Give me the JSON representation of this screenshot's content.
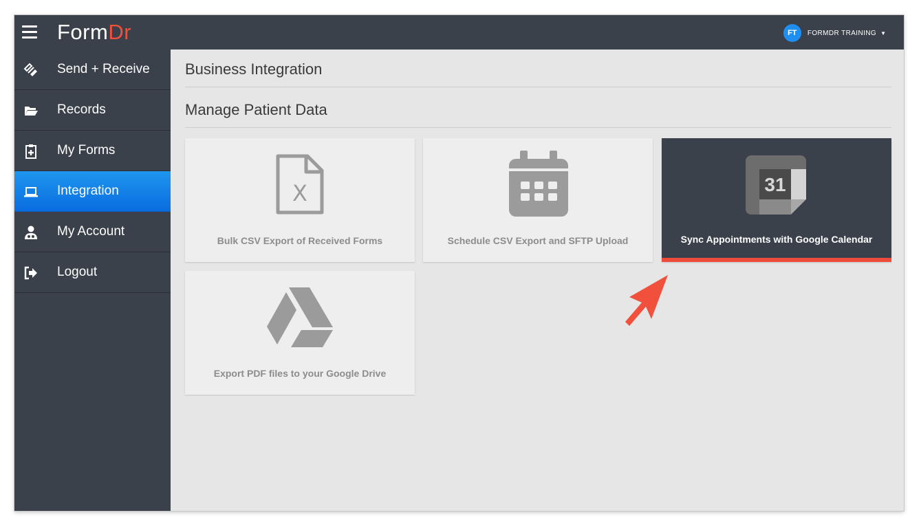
{
  "app": {
    "logo_form": "Form",
    "logo_dr": "Dr",
    "user_initials": "FT",
    "user_name": "FORMDR TRAINING",
    "user_caret": "▼"
  },
  "sidebar": {
    "items": [
      {
        "label": "Send + Receive",
        "icon": "send-receive-icon",
        "active": false
      },
      {
        "label": "Records",
        "icon": "folder-open-icon",
        "active": false
      },
      {
        "label": "My Forms",
        "icon": "clipboard-plus-icon",
        "active": false
      },
      {
        "label": "Integration",
        "icon": "laptop-icon",
        "active": true
      },
      {
        "label": "My Account",
        "icon": "user-doctor-icon",
        "active": false
      },
      {
        "label": "Logout",
        "icon": "sign-out-icon",
        "active": false
      }
    ]
  },
  "main": {
    "title": "Business Integration",
    "section_title": "Manage Patient Data",
    "tiles": [
      {
        "label": "Bulk CSV Export of Received Forms",
        "icon": "excel-file-icon",
        "selected": false
      },
      {
        "label": "Schedule CSV Export and SFTP Upload",
        "icon": "calendar-icon",
        "selected": false
      },
      {
        "label": "Sync Appointments with Google Calendar",
        "icon": "google-calendar-icon",
        "calendar_day": "31",
        "selected": true
      },
      {
        "label": "Export PDF files to your Google Drive",
        "icon": "google-drive-icon",
        "selected": false
      }
    ]
  },
  "annotation": {
    "icon": "pointer-arrow-icon",
    "color": "#f0503c"
  },
  "colors": {
    "topbar": "#3a414a",
    "active_nav": "#0a6de0",
    "accent": "#ef4b3a",
    "avatar": "#1e8ff0"
  }
}
